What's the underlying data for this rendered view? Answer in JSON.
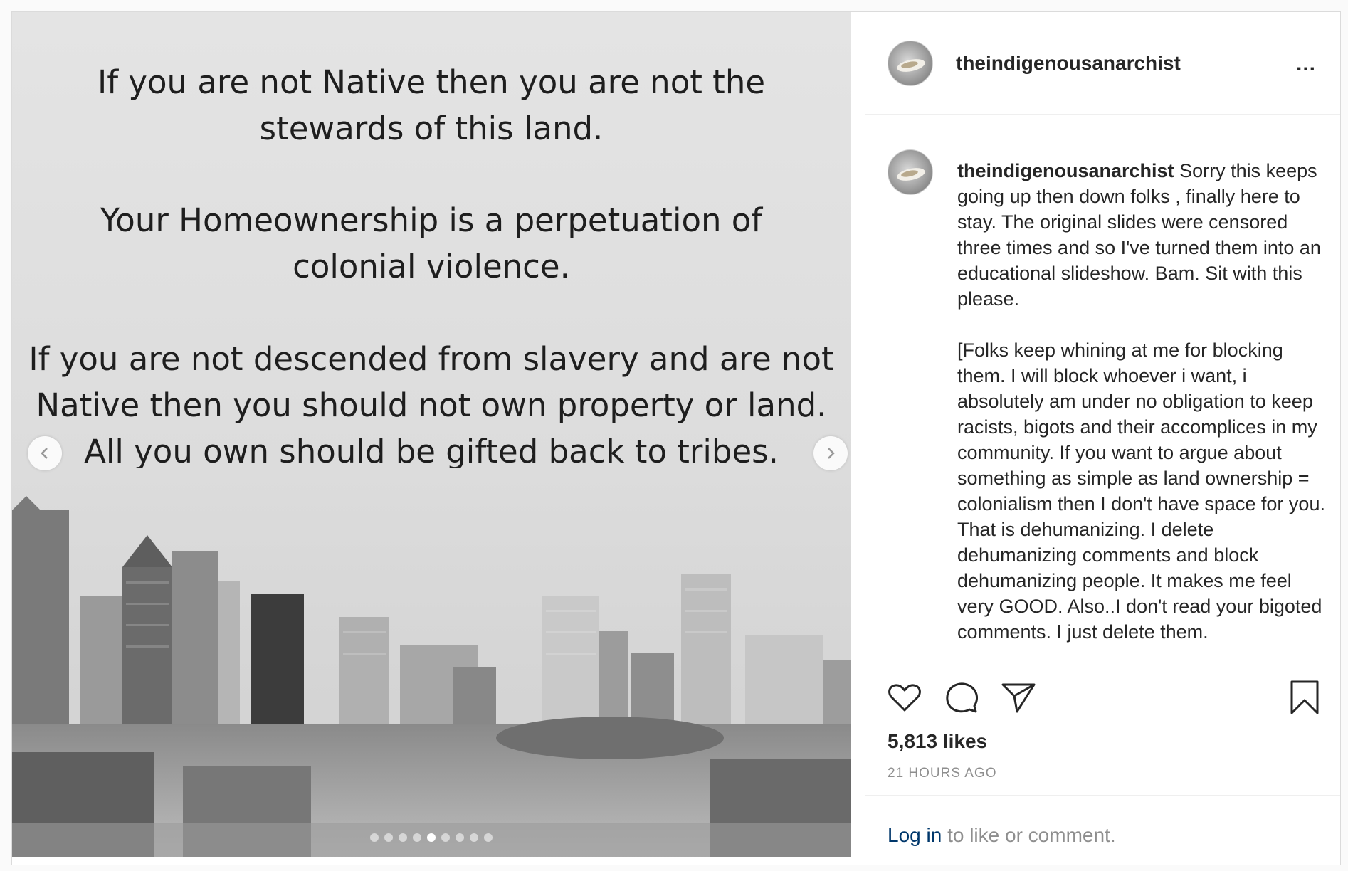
{
  "slide": {
    "text_block_1": "If you are not Native then you are not the stewards of this land.",
    "text_block_1_lines": [
      "If you are not Native then you are not the",
      "stewards of this land."
    ],
    "text_block_2_lines": [
      "Your Homeownership is a perpetuation of",
      "colonial violence."
    ],
    "text_block_3_lines": [
      "If you are not descended from slavery and are not",
      "Native then you should not own property or land.",
      "All you own should be gifted back to tribes."
    ],
    "current_index": 5,
    "total": 9
  },
  "header": {
    "username": "theindigenousanarchist",
    "more_label": "..."
  },
  "caption": {
    "username": "theindigenousanarchist",
    "paragraph_1": "Sorry this keeps going up then down folks , finally here to stay. The original slides were censored three times and so I've turned them into an educational slideshow. Bam. Sit with this please.",
    "paragraph_2": "[Folks keep whining at me for blocking them. I will block whoever i want, i absolutely am under no obligation to keep racists, bigots and their accomplices in my community. If you want to argue about something as simple as land ownership = colonialism then I don't have space for you. That is dehumanizing. I delete dehumanizing comments and block dehumanizing people. It makes me feel very GOOD. Also..I don't read your bigoted comments. I just delete them."
  },
  "actions": {
    "likes": "5,813 likes",
    "time": "21 HOURS AGO"
  },
  "login": {
    "link": "Log in",
    "rest": " to like or comment."
  },
  "icons": {
    "like": "heart-icon",
    "comment": "comment-icon",
    "share": "paper-plane-icon",
    "save": "bookmark-icon",
    "prev": "chevron-left-icon",
    "next": "chevron-right-icon"
  },
  "colors": {
    "link": "#00376b",
    "muted": "#8e8e8e",
    "text": "#262626",
    "border": "#dbdbdb"
  }
}
